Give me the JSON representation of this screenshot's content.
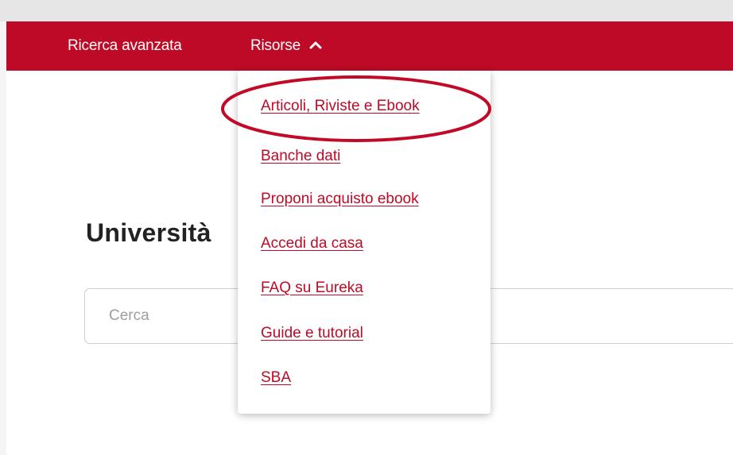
{
  "nav": {
    "advanced_search": "Ricerca avanzata",
    "resources": "Risorse"
  },
  "page": {
    "title": "Università"
  },
  "search": {
    "placeholder": "Cerca"
  },
  "dropdown": {
    "items": [
      {
        "label": "Articoli, Riviste e Ebook"
      },
      {
        "label": "Banche dati"
      },
      {
        "label": "Proponi acquisto ebook"
      },
      {
        "label": "Accedi da casa"
      },
      {
        "label": "FAQ su Eureka"
      },
      {
        "label": "Guide e tutorial"
      },
      {
        "label": "SBA"
      }
    ]
  },
  "colors": {
    "brand_red": "#be0a26",
    "highlight_ring": "#c20a27"
  }
}
